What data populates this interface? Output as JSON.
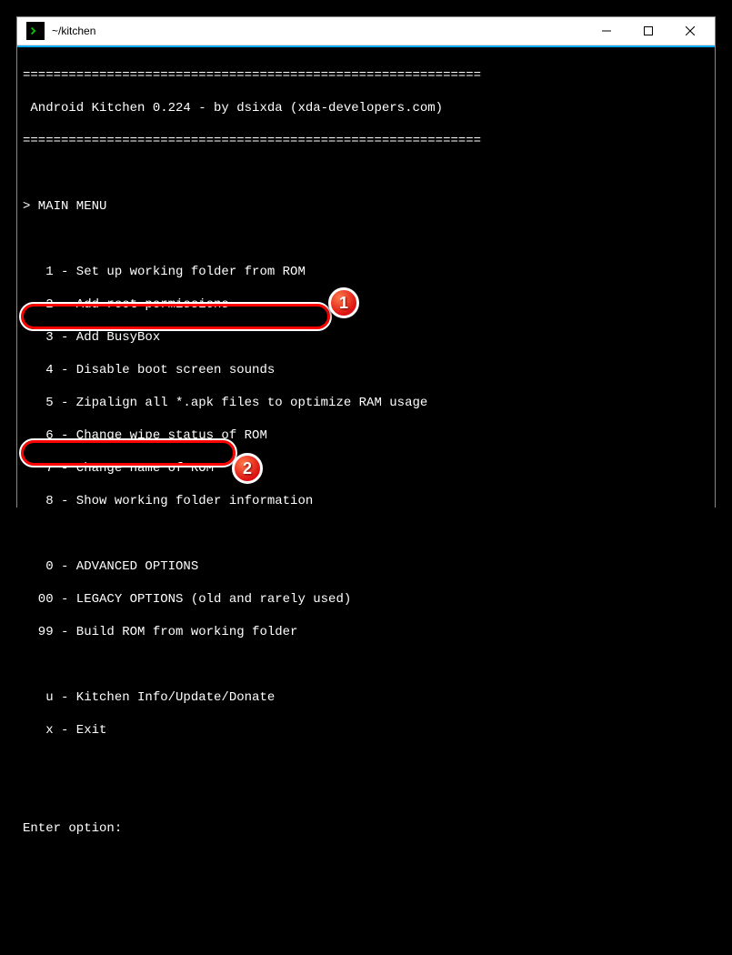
{
  "window": {
    "title": "~/kitchen"
  },
  "terminal": {
    "divider": "============================================================",
    "header": " Android Kitchen 0.224 - by dsixda (xda-developers.com)",
    "menu_header": "> MAIN MENU",
    "items": {
      "i1": "   1 - Set up working folder from ROM",
      "i2": "   2 - Add root permissions",
      "i3": "   3 - Add BusyBox",
      "i4": "   4 - Disable boot screen sounds",
      "i5": "   5 - Zipalign all *.apk files to optimize RAM usage",
      "i6": "   6 - Change wipe status of ROM",
      "i7": "   7 - Change name of ROM",
      "i8": "   8 - Show working folder information",
      "i0": "   0 - ADVANCED OPTIONS",
      "i00": "  00 - LEGACY OPTIONS (old and rarely used)",
      "i99": "  99 - Build ROM from working folder",
      "iu": "   u - Kitchen Info/Update/Donate",
      "ix": "   x - Exit"
    },
    "prompt": "Enter option:"
  },
  "markers": {
    "m1": "1",
    "m2": "2"
  }
}
